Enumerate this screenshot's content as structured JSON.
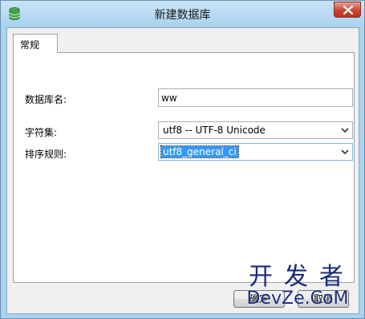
{
  "window": {
    "title": "新建数据库"
  },
  "tabs": [
    {
      "label": "常规"
    }
  ],
  "form": {
    "db_name": {
      "label": "数据库名:",
      "value": "ww"
    },
    "charset": {
      "label": "字符集:",
      "value": "utf8 -- UTF-8 Unicode"
    },
    "collation": {
      "label": "排序规则:",
      "value": "utf8_general_ci"
    }
  },
  "buttons": {
    "ok_label": "确定",
    "cancel_label": "取消"
  },
  "watermark": {
    "line1": "开发者",
    "line2": "DevZe.CoM"
  },
  "colors": {
    "title_bar": "#a9d2ee",
    "close_button": "#c94532",
    "selection": "#3399ff"
  },
  "icons": {
    "app": "database-icon",
    "close": "close-icon",
    "dropdown": "chevron-down-icon"
  }
}
